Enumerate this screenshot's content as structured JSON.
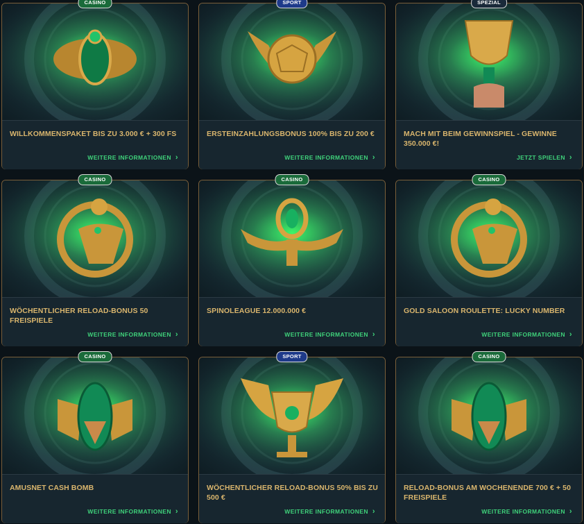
{
  "colors": {
    "accent_gold": "#d9b56d",
    "link_green": "#3fd17a",
    "card_bg": "#17262f",
    "page_bg": "#0b1318"
  },
  "cards": [
    {
      "badge": "CASINO",
      "badge_type": "casino",
      "title": "WILLKOMMENSPAKET BIS ZU 3.000 € + 300 FS",
      "link": "WEITERE INFORMATIONEN",
      "icon": "scarab-icon"
    },
    {
      "badge": "SPORT",
      "badge_type": "sport",
      "title": "ERSTEINZAHLUNGSBONUS 100% BIS ZU 200 €",
      "link": "WEITERE INFORMATIONEN",
      "icon": "winged-ball-icon"
    },
    {
      "badge": "SPEZIAL",
      "badge_type": "spezial",
      "title": "MACH MIT BEIM GEWINNSPIEL - GEWINNE 350.000 €!",
      "link": "JETZT SPIELEN",
      "icon": "trophy-cup-icon"
    },
    {
      "badge": "CASINO",
      "badge_type": "casino",
      "title": "WÖCHENTLICHER RELOAD-BONUS 50 FREISPIELE",
      "link": "WEITERE INFORMATIONEN",
      "icon": "horus-falcon-icon"
    },
    {
      "badge": "CASINO",
      "badge_type": "casino",
      "title": "SPINOLEAGUE 12.000.000 €",
      "link": "WEITERE INFORMATIONEN",
      "icon": "winged-ankh-icon"
    },
    {
      "badge": "CASINO",
      "badge_type": "casino",
      "title": "GOLD SALOON ROULETTE: LUCKY NUMBER",
      "link": "WEITERE INFORMATIONEN",
      "icon": "horus-falcon-icon"
    },
    {
      "badge": "CASINO",
      "badge_type": "casino",
      "title": "AMUSNET CASH BOMB",
      "link": "WEITERE INFORMATIONEN",
      "icon": "serpent-jackal-icon"
    },
    {
      "badge": "SPORT",
      "badge_type": "sport",
      "title": "WÖCHENTLICHER RELOAD-BONUS 50% BIS ZU 500 €",
      "link": "WEITERE INFORMATIONEN",
      "icon": "winged-chalice-icon"
    },
    {
      "badge": "CASINO",
      "badge_type": "casino",
      "title": "RELOAD-BONUS AM WOCHENENDE 700 € + 50 FREISPIELE",
      "link": "WEITERE INFORMATIONEN",
      "icon": "serpent-jackal-icon"
    }
  ]
}
